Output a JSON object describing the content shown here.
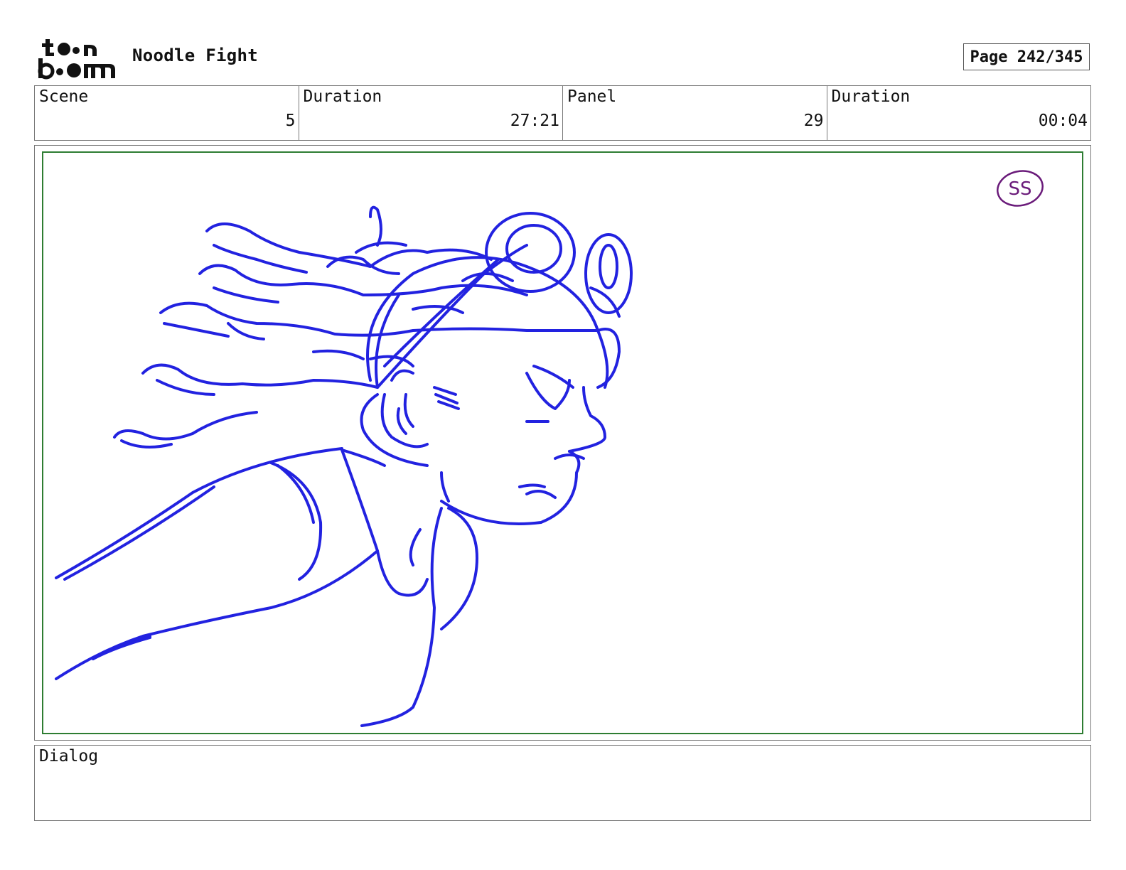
{
  "header": {
    "logo_text": "toon boom",
    "project_title": "Noodle Fight",
    "page_label": "Page 242/345"
  },
  "info": [
    {
      "label": "Scene",
      "value": "5"
    },
    {
      "label": "Duration",
      "value": "27:21"
    },
    {
      "label": "Panel",
      "value": "29"
    },
    {
      "label": "Duration",
      "value": "00:04"
    }
  ],
  "panel": {
    "initials_stamp": "SS",
    "sketch_color": "#2222e0",
    "stamp_color": "#6a1b7a",
    "frame_color": "#2e7d32"
  },
  "dialog": {
    "label": "Dialog",
    "text": ""
  }
}
